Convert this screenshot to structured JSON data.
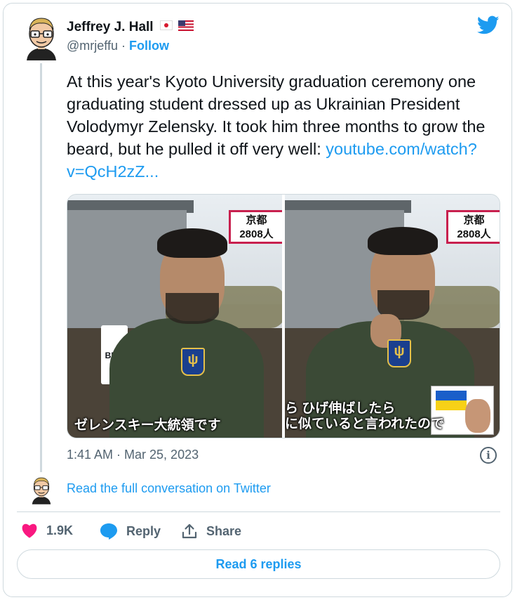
{
  "author": {
    "name": "Jeffrey J. Hall",
    "handle": "@mrjeffu",
    "separator": "·",
    "follow_label": "Follow",
    "flags": [
      "jp-flag-icon",
      "us-flag-icon"
    ]
  },
  "tweet": {
    "text": "At this year's Kyoto University graduation ceremony one graduating student dressed up as Ukrainian President Volodymyr Zelensky. It took him three months to grow the beard, but he pulled it off very well: ",
    "link": "youtube.com/watch?v=QcH2zZ...",
    "timestamp": "1:41 AM · Mar 25, 2023"
  },
  "media": {
    "photos": [
      {
        "tag_line1": "京都",
        "tag_line2": "2808人",
        "sign_text": "BBQ",
        "caption": "ゼレンスキー大統領です"
      },
      {
        "tag_line1": "京都",
        "tag_line2": "2808人",
        "caption_line1": "ら ひげ伸ばしたら",
        "caption_line2": "に似ていると言われたので"
      }
    ]
  },
  "conversation": {
    "read_full_label": "Read the full conversation on Twitter"
  },
  "actions": {
    "like_count": "1.9K",
    "reply_label": "Reply",
    "share_label": "Share",
    "read_replies_label": "Read 6 replies"
  },
  "colors": {
    "accent": "#1d9bf0",
    "like": "#f91880",
    "muted": "#536471",
    "border": "#cfd9de"
  }
}
